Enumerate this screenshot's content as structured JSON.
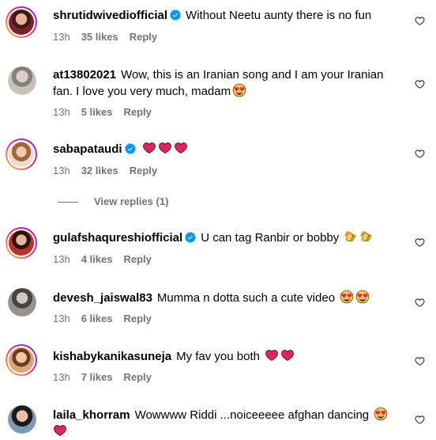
{
  "colors": {
    "text": "#000000",
    "meta": "#737373",
    "verified": "#0095f6",
    "heart_emoji": "#e0245e"
  },
  "comments": [
    {
      "username": "shrutidwivediofficial",
      "verified": true,
      "text": "Without Neetu aunty there is no fun",
      "emoji": [],
      "time": "13h",
      "likes": "35 likes",
      "reply": "Reply"
    },
    {
      "username": "at13802021",
      "verified": false,
      "text": "Wow, this is an Iranian song and I am your Iranian fan. I love you very much, madam",
      "emoji": [
        "heart-eyes"
      ],
      "time": "13h",
      "likes": "5 likes",
      "reply": "Reply"
    },
    {
      "username": "sabapataudi",
      "verified": true,
      "text": "",
      "emoji": [
        "heart",
        "heart",
        "heart"
      ],
      "time": "13h",
      "likes": "32 likes",
      "reply": "Reply",
      "view_replies": "View replies (1)"
    },
    {
      "username": "gulafshaqureshiofficial",
      "verified": true,
      "text": "U can tag Ranbir or bobby",
      "emoji": [
        "clap",
        "clap"
      ],
      "time": "13h",
      "likes": "4 likes",
      "reply": "Reply"
    },
    {
      "username": "devesh_jaiswal83",
      "verified": false,
      "text": "Mumma n dotta such a cute video",
      "emoji": [
        "heart-eyes",
        "heart-eyes"
      ],
      "time": "13h",
      "likes": "6 likes",
      "reply": "Reply"
    },
    {
      "username": "kishabykanikasuneja",
      "verified": false,
      "text": "My fav you both",
      "emoji": [
        "heart",
        "heart"
      ],
      "time": "13h",
      "likes": "7 likes",
      "reply": "Reply"
    },
    {
      "username": "laila_khorram",
      "verified": false,
      "text": "Wowwww Riddi ...noiceeeee afghan dancing",
      "emoji": [
        "heart-eyes"
      ],
      "emoji_line2": [
        "heart"
      ],
      "time": "",
      "likes": "",
      "reply": ""
    }
  ],
  "icons": {
    "like_button": "heart-outline-icon",
    "verified_badge": "verified-badge-icon"
  }
}
